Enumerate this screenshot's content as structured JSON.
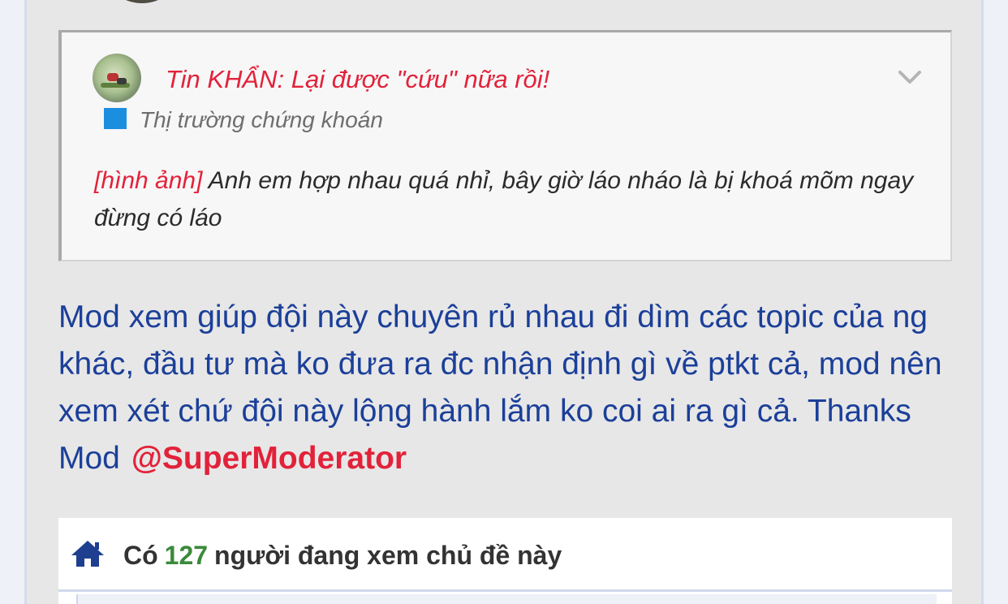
{
  "quote": {
    "title": "Tin KHẨN: Lại được \"cứu\" nữa rồi!",
    "category": "Thị trường chứng khoán",
    "image_tag": "[hình ảnh]",
    "body": " Anh em hợp nhau quá nhỉ, bây giờ láo nháo là bị khoá mõm ngay đừng có láo"
  },
  "post": {
    "body": "Mod xem giúp đội này chuyên rủ nhau đi dìm các topic của ng khác, đầu tư mà ko đưa ra đc nhận định gì về ptkt cả, mod nên xem xét chứ đội này lộng hành lắm ko coi ai ra gì cả. Thanks Mod",
    "mention": "@SuperModerator"
  },
  "viewers": {
    "prefix": "Có",
    "count": "127",
    "suffix": "người đang xem chủ đề này"
  },
  "colors": {
    "accent_red": "#e2223a",
    "post_blue": "#1b3f99",
    "count_green": "#3a8a3a",
    "category_blue": "#1c8ee0"
  },
  "icons": [
    "avatar",
    "chevron-down-icon",
    "home-icon"
  ]
}
